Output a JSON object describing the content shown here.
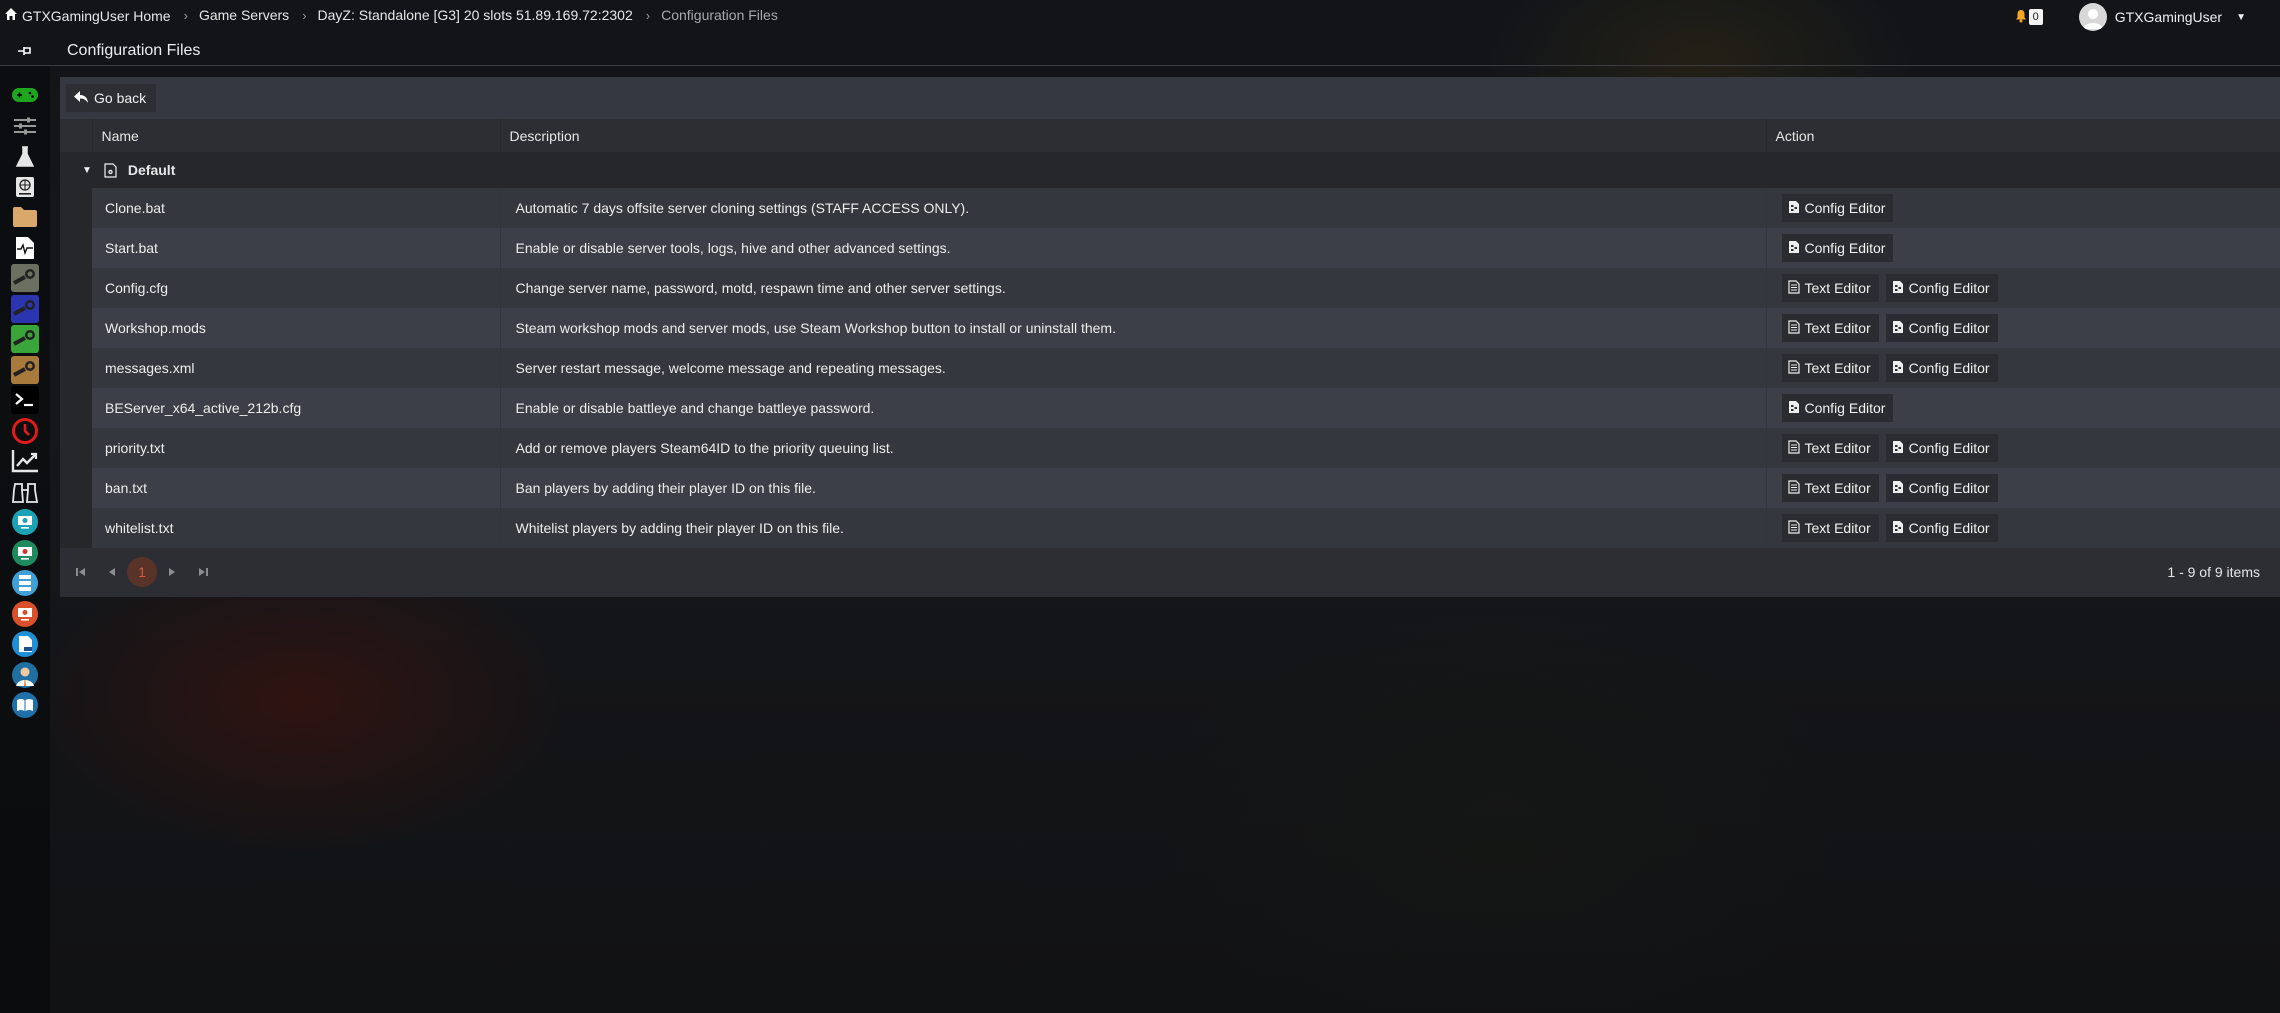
{
  "breadcrumb": {
    "items": [
      {
        "label": "GTXGamingUser Home",
        "icon": "home-icon"
      },
      {
        "label": "Game Servers"
      },
      {
        "label": "DayZ: Standalone [G3] 20 slots 51.89.169.72:2302"
      },
      {
        "label": "Configuration Files",
        "current": true
      }
    ]
  },
  "header": {
    "notifications": {
      "icon": "bell-icon",
      "count": "0"
    },
    "user": {
      "name": "GTXGamingUser",
      "avatar": "avatar-placeholder"
    }
  },
  "page": {
    "title": "Configuration Files",
    "pin_icon": "pin-icon"
  },
  "sidebar": {
    "items": [
      {
        "icon": "gamepad-icon",
        "color": "#2bb52b"
      },
      {
        "icon": "sliders-icon",
        "color": "#9a9a9a"
      },
      {
        "icon": "flask-icon",
        "color": "#e6e6e6"
      },
      {
        "icon": "globe-book-icon",
        "color": "#e6e6e6"
      },
      {
        "icon": "folder-icon",
        "color": "#d9a86a"
      },
      {
        "icon": "file-pulse-icon",
        "color": "#ffffff"
      },
      {
        "icon": "steam-grey-icon",
        "color": "#6c7060"
      },
      {
        "icon": "steam-blue-icon",
        "color": "#2b35b0"
      },
      {
        "icon": "steam-green-icon",
        "color": "#3aa53a"
      },
      {
        "icon": "steam-orange-icon",
        "color": "#a87a3c"
      },
      {
        "icon": "terminal-icon",
        "color": "#ffffff"
      },
      {
        "icon": "clock-icon",
        "color": "#e01b1b"
      },
      {
        "icon": "chart-line-icon",
        "color": "#e6e6e6"
      },
      {
        "icon": "binoculars-icon",
        "color": "#e6e6e6"
      },
      {
        "icon": "monitor-teal-icon",
        "color": "#1ba3b5"
      },
      {
        "icon": "monitor-green-icon",
        "color": "#1e8a5e"
      },
      {
        "icon": "server-list-icon",
        "color": "#3fa0d8"
      },
      {
        "icon": "monitor-red-icon",
        "color": "#d9502a"
      },
      {
        "icon": "document-blue-icon",
        "color": "#1f8fd8"
      },
      {
        "icon": "support-agent-icon",
        "color": "#1f6fa0"
      },
      {
        "icon": "book-open-icon",
        "color": "#1f6fa8"
      }
    ]
  },
  "toolbar": {
    "back_label": "Go back"
  },
  "table": {
    "columns": {
      "name": "Name",
      "description": "Description",
      "action": "Action"
    },
    "group": {
      "label": "Default"
    },
    "buttons": {
      "text_editor": "Text Editor",
      "config_editor": "Config Editor"
    },
    "rows": [
      {
        "name": "Clone.bat",
        "description": "Automatic 7 days offsite server cloning settings (STAFF ACCESS ONLY).",
        "text_editor": false,
        "config_editor": true
      },
      {
        "name": "Start.bat",
        "description": "Enable or disable server tools, logs, hive and other advanced settings.",
        "text_editor": false,
        "config_editor": true
      },
      {
        "name": "Config.cfg",
        "description": "Change server name, password, motd, respawn time and other server settings.",
        "text_editor": true,
        "config_editor": true
      },
      {
        "name": "Workshop.mods",
        "description": "Steam workshop mods and server mods, use Steam Workshop button to install or uninstall them.",
        "text_editor": true,
        "config_editor": true
      },
      {
        "name": "messages.xml",
        "description": "Server restart message, welcome message and repeating messages.",
        "text_editor": true,
        "config_editor": true
      },
      {
        "name": "BEServer_x64_active_212b.cfg",
        "description": "Enable or disable battleye and change battleye password.",
        "text_editor": false,
        "config_editor": true
      },
      {
        "name": "priority.txt",
        "description": "Add or remove players Steam64ID to the priority queuing list.",
        "text_editor": true,
        "config_editor": true
      },
      {
        "name": "ban.txt",
        "description": "Ban players by adding their player ID on this file.",
        "text_editor": true,
        "config_editor": true
      },
      {
        "name": "whitelist.txt",
        "description": "Whitelist players by adding their player ID on this file.",
        "text_editor": true,
        "config_editor": true
      }
    ]
  },
  "pager": {
    "current_page": "1",
    "info": "1 - 9 of 9 items"
  },
  "colors": {
    "accent_page": "#d55a3a",
    "bell": "#f5a623"
  }
}
